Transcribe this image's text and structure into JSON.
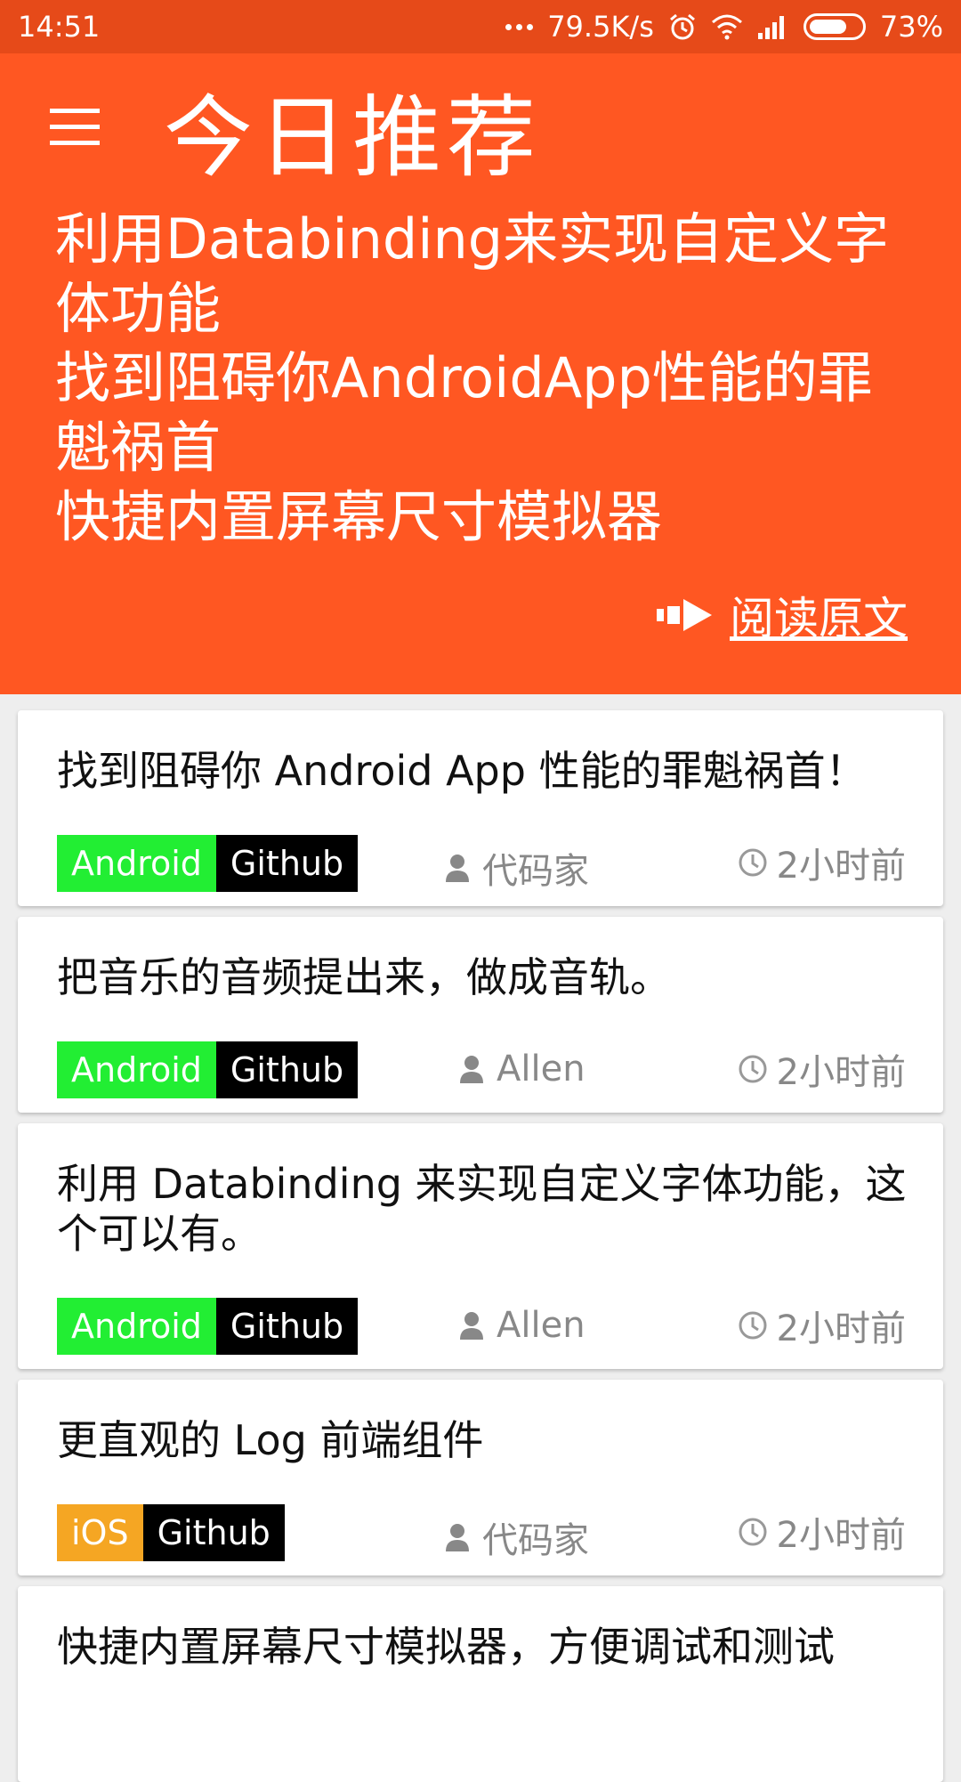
{
  "status_bar": {
    "time": "14:51",
    "net_speed": "79.5K/s",
    "battery": "73%",
    "battery_level": 0.73
  },
  "header": {
    "title": "今日推荐",
    "summary": [
      "利用Databinding来实现自定义字体功能",
      "找到阻碍你AndroidApp性能的罪魁祸首",
      "快捷内置屏幕尺寸模拟器"
    ],
    "read_more": "阅读原文"
  },
  "colors": {
    "status_bar": "#e64a19",
    "header_bg": "#ff5722",
    "android_tag": "#22ee33",
    "ios_tag": "#f5a623",
    "github_tag": "#000000"
  },
  "articles": [
    {
      "title": "找到阻碍你 Android App 性能的罪魁祸首！",
      "tags": [
        "Android",
        "Github"
      ],
      "author": "代码家",
      "time": "2小时前"
    },
    {
      "title": "把音乐的音频提出来，做成音轨。",
      "tags": [
        "Android",
        "Github"
      ],
      "author": "Allen",
      "time": "2小时前"
    },
    {
      "title": "利用 Databinding 来实现自定义字体功能，这个可以有。",
      "tags": [
        "Android",
        "Github"
      ],
      "author": "Allen",
      "time": "2小时前"
    },
    {
      "title": "更直观的 Log 前端组件",
      "tags": [
        "iOS",
        "Github"
      ],
      "author": "代码家",
      "time": "2小时前"
    },
    {
      "title": "快捷内置屏幕尺寸模拟器，方便调试和测试"
    }
  ],
  "icons": {
    "menu": "hamburger-menu-icon",
    "read_more": "arrow-right-icon",
    "author": "person-icon",
    "time": "clock-icon"
  }
}
